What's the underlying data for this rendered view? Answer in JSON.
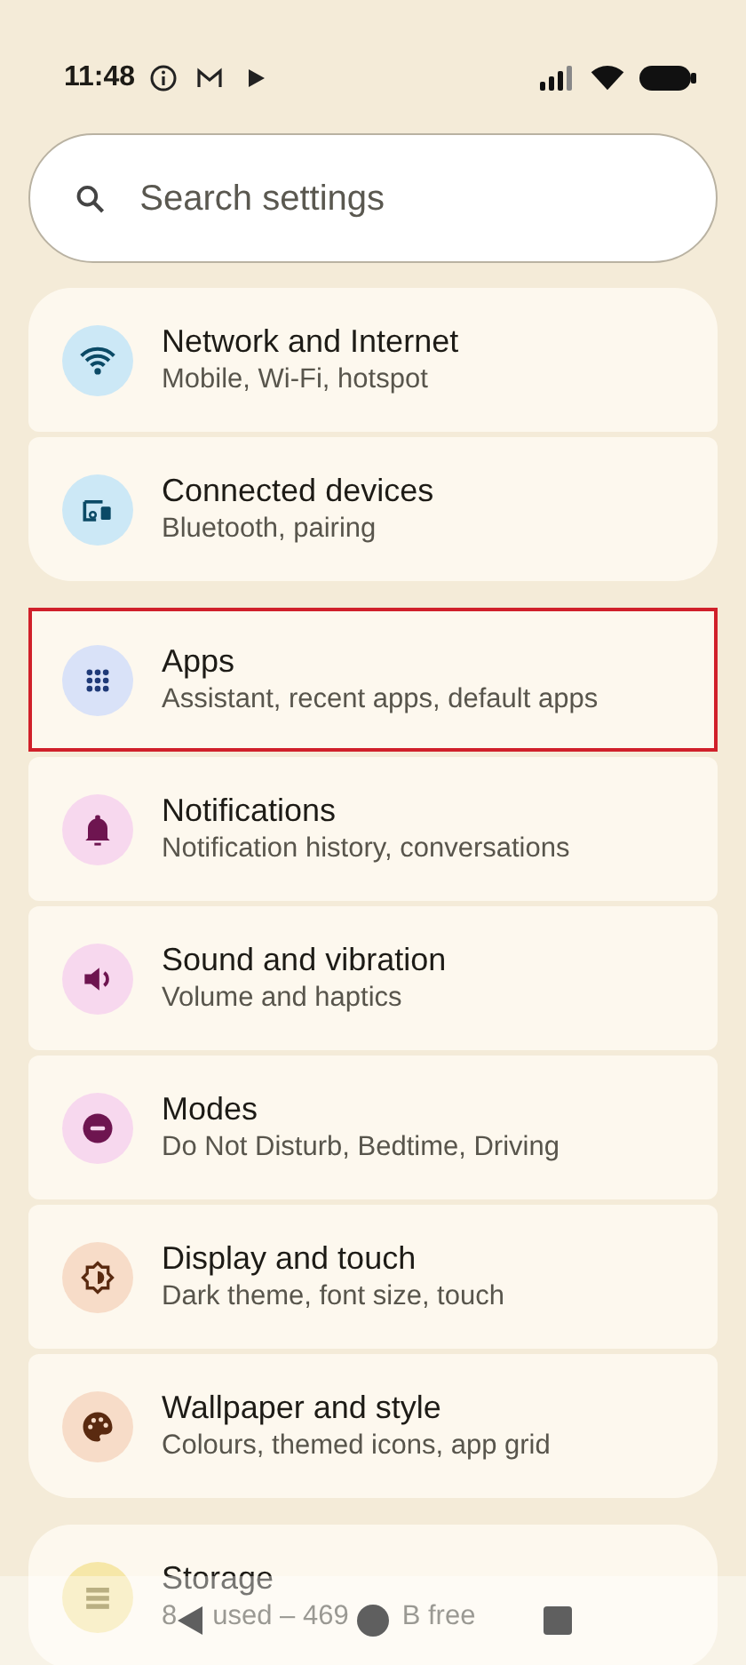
{
  "status_bar": {
    "time": "11:48",
    "notifications": [
      {
        "kind": "info"
      },
      {
        "kind": "mail"
      },
      {
        "kind": "play"
      }
    ]
  },
  "search": {
    "placeholder": "Search settings"
  },
  "groups": [
    {
      "items": [
        {
          "kind": "wifi",
          "title": "Network and Internet",
          "subtitle": "Mobile, Wi-Fi, hotspot",
          "color": "#cce8f6",
          "highlighted": false
        },
        {
          "kind": "devices",
          "title": "Connected devices",
          "subtitle": "Bluetooth, pairing",
          "color": "#cce8f6",
          "highlighted": false
        }
      ]
    },
    {
      "items": [
        {
          "kind": "apps",
          "title": "Apps",
          "subtitle": "Assistant, recent apps, default apps",
          "color": "#d9e2f8",
          "highlighted": true
        },
        {
          "kind": "bell",
          "title": "Notifications",
          "subtitle": "Notification history, conversations",
          "color": "#f7d8ee",
          "highlighted": false
        },
        {
          "kind": "sound",
          "title": "Sound and vibration",
          "subtitle": "Volume and haptics",
          "color": "#f7d8ee",
          "highlighted": false
        },
        {
          "kind": "modes",
          "title": "Modes",
          "subtitle": "Do Not Disturb, Bedtime, Driving",
          "color": "#f7d8ee",
          "highlighted": false
        },
        {
          "kind": "display",
          "title": "Display and touch",
          "subtitle": "Dark theme, font size, touch",
          "color": "#f7dcc8",
          "highlighted": false
        },
        {
          "kind": "palette",
          "title": "Wallpaper and style",
          "subtitle": "Colours, themed icons, app grid",
          "color": "#f7dcc8",
          "highlighted": false
        }
      ]
    },
    {
      "items": [
        {
          "kind": "storage",
          "title": "Storage",
          "subtitle_fragments": [
            "8",
            "used – 469",
            "B free"
          ],
          "color": "#f6e7a8",
          "highlighted": false
        }
      ]
    }
  ]
}
